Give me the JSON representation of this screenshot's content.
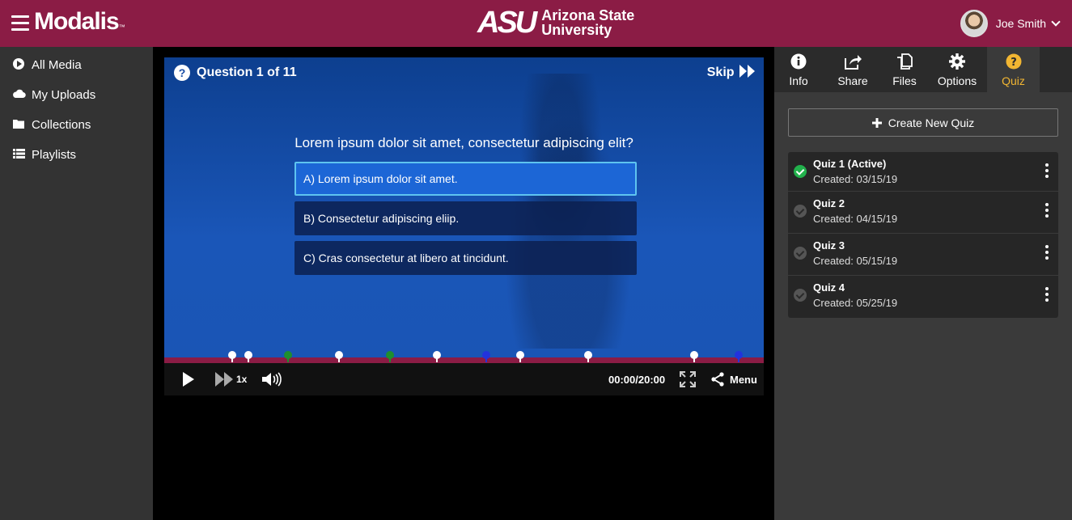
{
  "header": {
    "brand": "Modalis",
    "brand_tm": "™",
    "university_mark": "ASU",
    "university_line1": "Arizona State",
    "university_line2": "University",
    "user_name": "Joe Smith"
  },
  "sidebar": {
    "items": [
      {
        "label": "All Media",
        "icon": "play-circle-icon"
      },
      {
        "label": "My Uploads",
        "icon": "cloud-icon"
      },
      {
        "label": "Collections",
        "icon": "folder-icon"
      },
      {
        "label": "Playlists",
        "icon": "list-icon"
      }
    ]
  },
  "player": {
    "question_counter": "Question 1 of 11",
    "skip_label": "Skip",
    "question": "Lorem ipsum dolor sit amet, consectetur adipiscing elit?",
    "answers": [
      "A) Lorem ipsum dolor sit amet.",
      "B) Consectetur adipiscing eliip.",
      "C) Cras consectetur at libero at tincidunt."
    ],
    "speed": "1x",
    "time": "00:00/20:00",
    "menu_label": "Menu",
    "progress_color": "#8b1c45",
    "markers": [
      {
        "color": "#ffffff",
        "pos": 0.113
      },
      {
        "color": "#ffffff",
        "pos": 0.14
      },
      {
        "color": "#1e8f2e",
        "pos": 0.207
      },
      {
        "color": "#ffffff",
        "pos": 0.292
      },
      {
        "color": "#1e8f2e",
        "pos": 0.376
      },
      {
        "color": "#ffffff",
        "pos": 0.455
      },
      {
        "color": "#2233dd",
        "pos": 0.537
      },
      {
        "color": "#ffffff",
        "pos": 0.594
      },
      {
        "color": "#ffffff",
        "pos": 0.707
      },
      {
        "color": "#ffffff",
        "pos": 0.884
      },
      {
        "color": "#2233dd",
        "pos": 0.958
      }
    ]
  },
  "rpanel": {
    "tabs": [
      {
        "label": "Info",
        "icon": "info-icon"
      },
      {
        "label": "Share",
        "icon": "share-icon"
      },
      {
        "label": "Files",
        "icon": "files-icon"
      },
      {
        "label": "Options",
        "icon": "gear-icon"
      },
      {
        "label": "Quiz",
        "icon": "question-icon"
      }
    ],
    "active_tab": "Quiz",
    "create_label": "Create New Quiz",
    "quizzes": [
      {
        "name": "Quiz 1 (Active)",
        "created": "Created: 03/15/19",
        "active": true
      },
      {
        "name": "Quiz 2",
        "created": "Created: 04/15/19",
        "active": false
      },
      {
        "name": "Quiz 3",
        "created": "Created: 05/15/19",
        "active": false
      },
      {
        "name": "Quiz 4",
        "created": "Created: 05/25/19",
        "active": false
      }
    ]
  },
  "colors": {
    "brand_maroon": "#8b1c45",
    "accent_gold": "#f2b632",
    "active_green": "#22b14c",
    "answer_selected": "#1c66d6"
  }
}
